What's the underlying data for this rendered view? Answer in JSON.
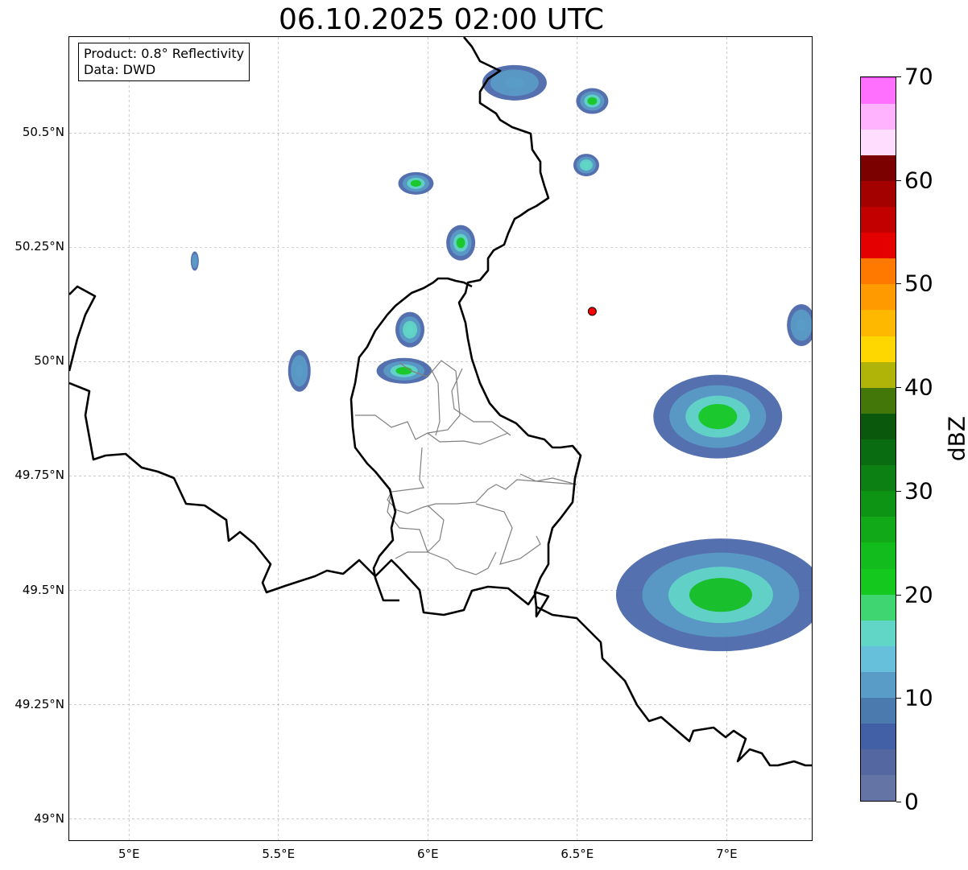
{
  "title": "06.10.2025 02:00 UTC",
  "info": {
    "product": "Product: 0.8° Reflectivity",
    "data": "Data: DWD"
  },
  "lat_ticks": [
    "50.5°N",
    "50.25°N",
    "50°N",
    "49.75°N",
    "49.5°N",
    "49.25°N",
    "49°N"
  ],
  "lon_ticks": [
    "5°E",
    "5.5°E",
    "6°E",
    "6.5°E",
    "7°E"
  ],
  "colorbar": {
    "label": "dBZ",
    "tick_labels": [
      "0",
      "10",
      "20",
      "30",
      "40",
      "50",
      "60",
      "70"
    ],
    "range": [
      0,
      70
    ],
    "step": 2.5,
    "colors": [
      "#6475a5",
      "#5467a0",
      "#4260a5",
      "#4a7aae",
      "#5a9cc8",
      "#66c0dc",
      "#62d6c6",
      "#3fd672",
      "#14c81e",
      "#12bc1c",
      "#11a918",
      "#0e9414",
      "#0c8012",
      "#0a6c10",
      "#0a580c",
      "#44770a",
      "#b1b408",
      "#ffd700",
      "#ffb800",
      "#ff9a00",
      "#ff7800",
      "#e40000",
      "#c20000",
      "#a30000",
      "#7b0000",
      "#ffddff",
      "#ffb3ff",
      "#ff70ff",
      "#ee3bee"
    ]
  },
  "marker": {
    "lat": 50.11,
    "lon": 6.55,
    "color": "#ff0000"
  },
  "radar_cells": [
    {
      "lat": 50.61,
      "lon": 6.29,
      "max_dbz": 10
    },
    {
      "lat": 50.57,
      "lon": 6.55,
      "max_dbz": 20
    },
    {
      "lat": 50.43,
      "lon": 6.53,
      "max_dbz": 15
    },
    {
      "lat": 50.39,
      "lon": 5.96,
      "max_dbz": 20
    },
    {
      "lat": 50.26,
      "lon": 6.11,
      "max_dbz": 20
    },
    {
      "lat": 50.22,
      "lon": 5.22,
      "max_dbz": 10
    },
    {
      "lat": 50.07,
      "lon": 5.94,
      "max_dbz": 15
    },
    {
      "lat": 49.98,
      "lon": 5.57,
      "max_dbz": 12
    },
    {
      "lat": 49.98,
      "lon": 5.92,
      "max_dbz": 22
    },
    {
      "lat": 49.88,
      "lon": 6.97,
      "max_dbz": 22
    },
    {
      "lat": 50.08,
      "lon": 7.25,
      "max_dbz": 12
    },
    {
      "lat": 49.49,
      "lon": 6.98,
      "max_dbz": 24
    }
  ]
}
